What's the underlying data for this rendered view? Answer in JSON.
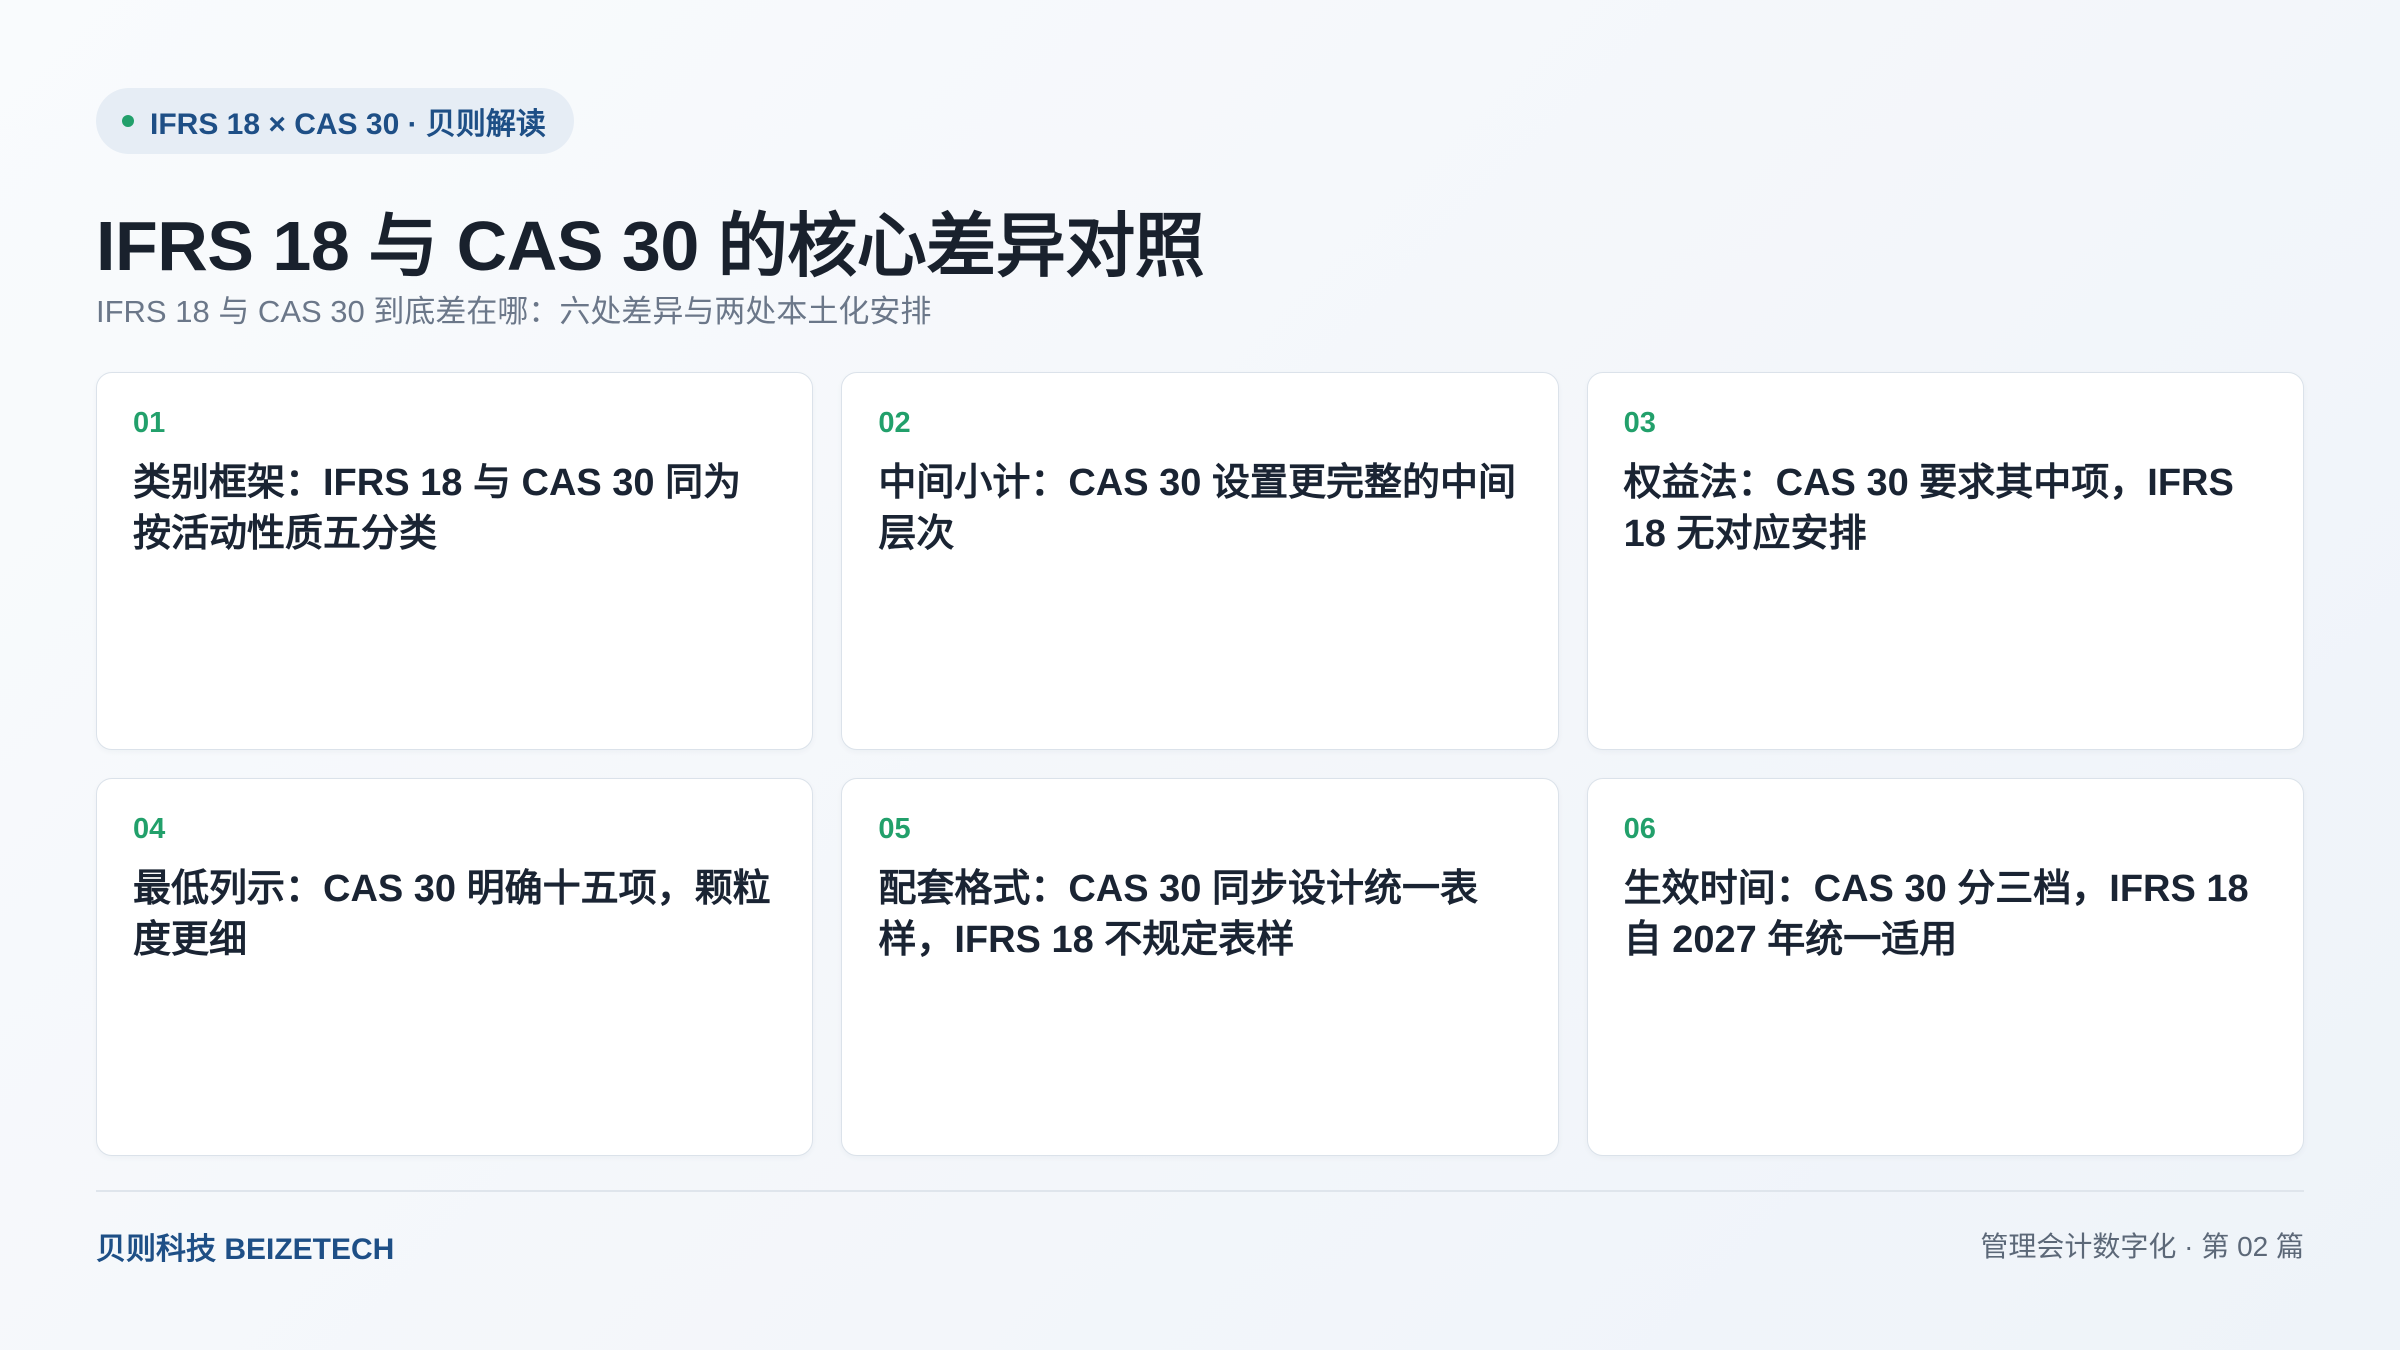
{
  "tag": {
    "label": "IFRS 18 × CAS 30 · 贝则解读",
    "dot_color": "#22a06b"
  },
  "title": "IFRS 18 与 CAS 30 的核心差异对照",
  "subtitle": "IFRS 18 与 CAS 30 到底差在哪：六处差异与两处本土化安排",
  "cards": [
    {
      "num": "01",
      "text": "类别框架：IFRS 18 与 CAS 30 同为按活动性质五分类"
    },
    {
      "num": "02",
      "text": "中间小计：CAS 30 设置更完整的中间层次"
    },
    {
      "num": "03",
      "text": "权益法：CAS 30 要求其中项，IFRS 18 无对应安排"
    },
    {
      "num": "04",
      "text": "最低列示：CAS 30 明确十五项，颗粒度更细"
    },
    {
      "num": "05",
      "text": "配套格式：CAS 30 同步设计统一表样，IFRS 18 不规定表样"
    },
    {
      "num": "06",
      "text": "生效时间：CAS 30 分三档，IFRS 18 自 2027 年统一适用"
    }
  ],
  "footer": {
    "brand": "贝则科技 BEIZETECH",
    "series": "管理会计数字化 · 第 02 篇"
  },
  "colors": {
    "accent_green": "#22a06b",
    "brand_blue": "#1e4f86"
  }
}
